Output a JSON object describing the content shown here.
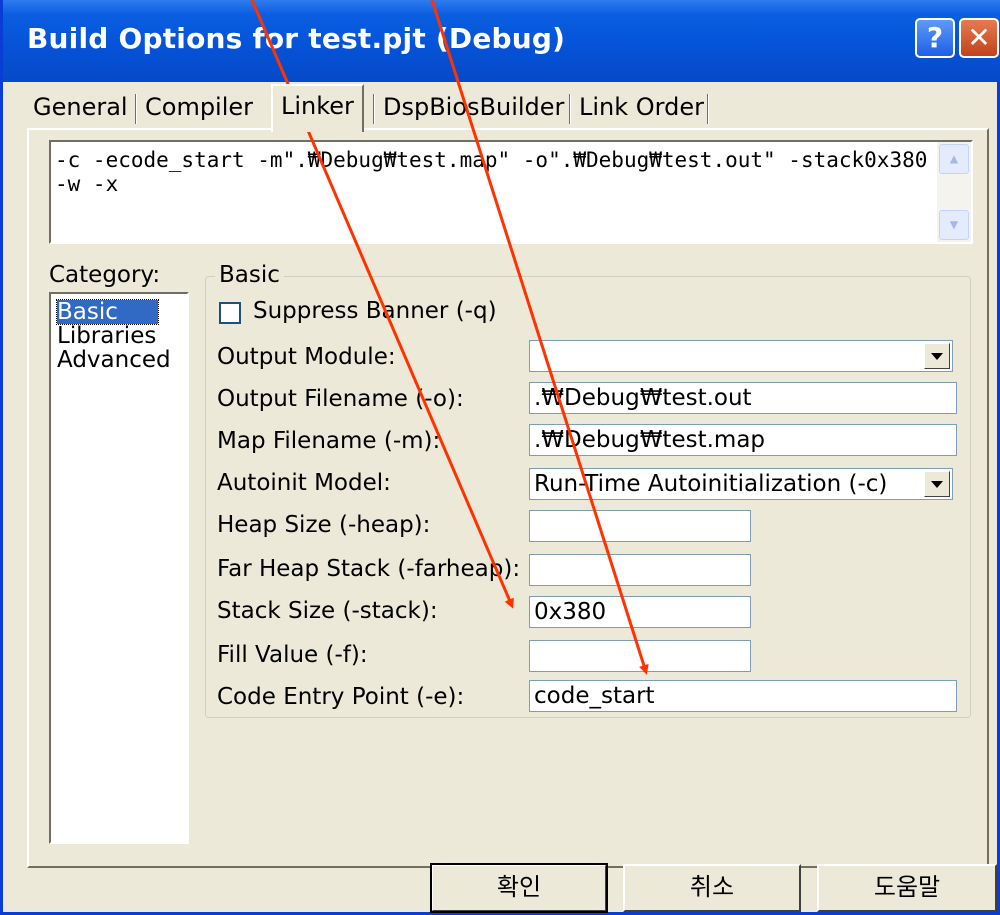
{
  "window": {
    "title": "Build Options for test.pjt (Debug)",
    "help_glyph": "?",
    "close_glyph": "✕"
  },
  "tabs": [
    {
      "label": "General"
    },
    {
      "label": "Compiler"
    },
    {
      "label": "Linker",
      "active": true
    },
    {
      "label": "DspBiosBuilder"
    },
    {
      "label": "Link Order"
    }
  ],
  "command_line": "-c -ecode_start -m\".₩Debug₩test.map\" -o\".₩Debug₩test.out\" -stack0x380 -w -x",
  "category": {
    "label": "Category:",
    "items": [
      "Basic",
      "Libraries",
      "Advanced"
    ],
    "selected": "Basic"
  },
  "basic": {
    "group_title": "Basic",
    "suppress_banner": {
      "label": "Suppress Banner (-q)",
      "checked": false
    },
    "output_module": {
      "label": "Output Module:",
      "value": ""
    },
    "output_filename": {
      "label": "Output Filename (-o):",
      "value": ".₩Debug₩test.out"
    },
    "map_filename": {
      "label": "Map Filename (-m):",
      "value": ".₩Debug₩test.map"
    },
    "autoinit_model": {
      "label": "Autoinit Model:",
      "value": "Run-Time Autoinitialization (-c)"
    },
    "heap_size": {
      "label": "Heap Size (-heap):",
      "value": ""
    },
    "far_heap_stack": {
      "label": "Far Heap Stack (-farheap):",
      "value": ""
    },
    "stack_size": {
      "label": "Stack Size (-stack):",
      "value": "0x380"
    },
    "fill_value": {
      "label": "Fill Value (-f):",
      "value": ""
    },
    "code_entry_point": {
      "label": "Code Entry Point (-e):",
      "value": "code_start"
    }
  },
  "buttons": {
    "ok": "확인",
    "cancel": "취소",
    "help": "도움말"
  },
  "annotation_color": "#ff3300"
}
